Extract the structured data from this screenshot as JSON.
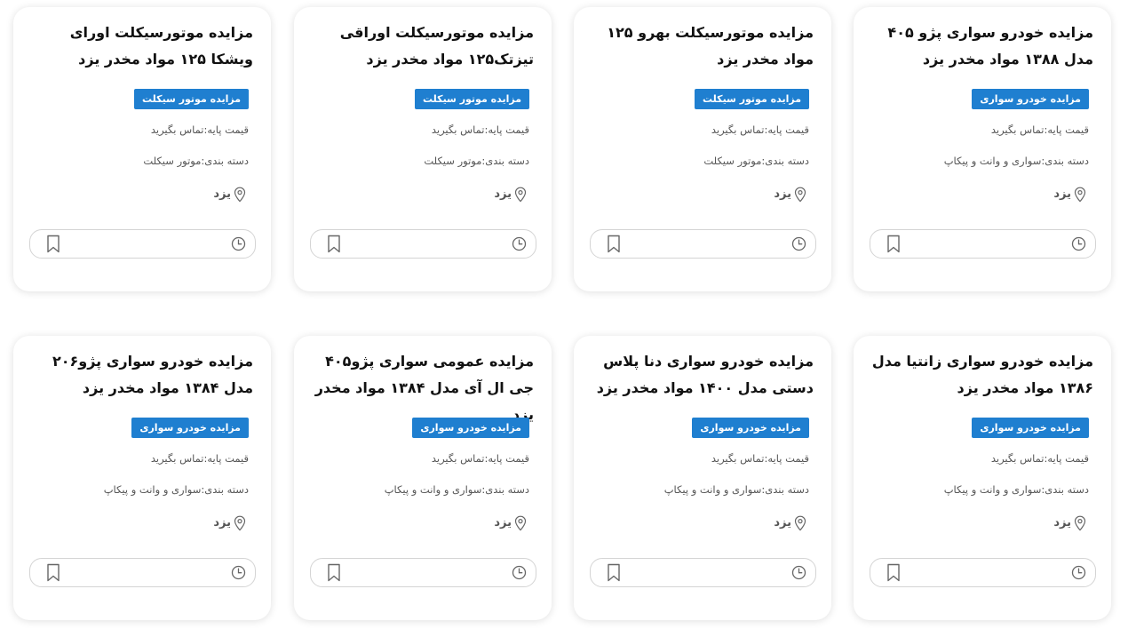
{
  "colors": {
    "badge_bg": "#1f7fd0",
    "badge_text": "#ffffff",
    "title": "#111111",
    "meta": "#555555",
    "icon": "#666666"
  },
  "cards": [
    {
      "title": "مزایده خودرو سواری پژو ۴۰۵ مدل ۱۳۸۸ مواد مخدر یزد",
      "badge": "مزایده خودرو سواری",
      "price": "قیمت پایه:تماس بگیرید",
      "category": "دسته بندی:سواری و وانت و پیکاپ",
      "city": "یزد",
      "icons": {
        "location": "location-pin-icon",
        "time": "clock-icon",
        "save": "bookmark-icon"
      }
    },
    {
      "title": "مزایده موتورسیکلت بهرو ۱۲۵ مواد مخدر یزد",
      "badge": "مزایده موتور سیکلت",
      "price": "قیمت پایه:تماس بگیرید",
      "category": "دسته بندی:موتور سیکلت",
      "city": "یزد",
      "icons": {
        "location": "location-pin-icon",
        "time": "clock-icon",
        "save": "bookmark-icon"
      }
    },
    {
      "title": "مزایده موتورسیکلت اوراقی تیزتک۱۲۵ مواد مخدر یزد",
      "badge": "مزایده موتور سیکلت",
      "price": "قیمت پایه:تماس بگیرید",
      "category": "دسته بندی:موتور سیکلت",
      "city": "یزد",
      "icons": {
        "location": "location-pin-icon",
        "time": "clock-icon",
        "save": "bookmark-icon"
      }
    },
    {
      "title": "مزایده موتورسیکلت اورای ویشکا ۱۲۵ مواد مخدر یزد",
      "badge": "مزایده موتور سیکلت",
      "price": "قیمت پایه:تماس بگیرید",
      "category": "دسته بندی:موتور سیکلت",
      "city": "یزد",
      "icons": {
        "location": "location-pin-icon",
        "time": "clock-icon",
        "save": "bookmark-icon"
      }
    },
    {
      "title": "مزایده خودرو سواری زانتیا مدل ۱۳۸۶ مواد مخدر یزد",
      "badge": "مزایده خودرو سواری",
      "price": "قیمت پایه:تماس بگیرید",
      "category": "دسته بندی:سواری و وانت و پیکاپ",
      "city": "یزد",
      "icons": {
        "location": "location-pin-icon",
        "time": "clock-icon",
        "save": "bookmark-icon"
      }
    },
    {
      "title": "مزایده خودرو سواری دنا پلاس دستی مدل ۱۴۰۰ مواد مخدر یزد",
      "badge": "مزایده خودرو سواری",
      "price": "قیمت پایه:تماس بگیرید",
      "category": "دسته بندی:سواری و وانت و پیکاپ",
      "city": "یزد",
      "icons": {
        "location": "location-pin-icon",
        "time": "clock-icon",
        "save": "bookmark-icon"
      }
    },
    {
      "title": "مزایده عمومی سواری پژو۴۰۵ جی ال آی مدل ۱۳۸۴ مواد مخدر یزد",
      "badge": "مزایده خودرو سواری",
      "price": "قیمت پایه:تماس بگیرید",
      "category": "دسته بندی:سواری و وانت و پیکاپ",
      "city": "یزد",
      "icons": {
        "location": "location-pin-icon",
        "time": "clock-icon",
        "save": "bookmark-icon"
      }
    },
    {
      "title": "مزایده خودرو سواری پژو۲۰۶ مدل ۱۳۸۴ مواد مخدر یزد",
      "badge": "مزایده خودرو سواری",
      "price": "قیمت پایه:تماس بگیرید",
      "category": "دسته بندی:سواری و وانت و پیکاپ",
      "city": "یزد",
      "icons": {
        "location": "location-pin-icon",
        "time": "clock-icon",
        "save": "bookmark-icon"
      }
    }
  ]
}
